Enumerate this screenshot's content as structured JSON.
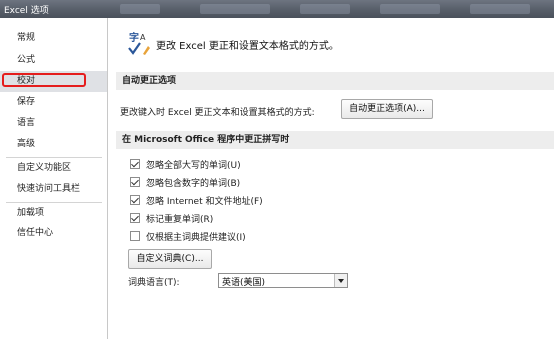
{
  "window": {
    "title": "Excel 选项"
  },
  "nav": {
    "items": [
      {
        "label": "常规"
      },
      {
        "label": "公式"
      },
      {
        "label": "校对"
      },
      {
        "label": "保存"
      },
      {
        "label": "语言"
      },
      {
        "label": "高级"
      },
      {
        "label": "自定义功能区"
      },
      {
        "label": "快速访问工具栏"
      },
      {
        "label": "加载项"
      },
      {
        "label": "信任中心"
      }
    ],
    "selected": "校对"
  },
  "main": {
    "header_icon": "abc-spellcheck-icon",
    "header_text": "更改 Excel 更正和设置文本格式的方式。",
    "autocorrect": {
      "section_title": "自动更正选项",
      "description": "更改键入时 Excel 更正文本和设置其格式的方式:",
      "button_label": "自动更正选项(A)..."
    },
    "spelling": {
      "section_title": "在 Microsoft Office 程序中更正拼写时",
      "options": [
        {
          "label": "忽略全部大写的单词(U)",
          "checked": true
        },
        {
          "label": "忽略包含数字的单词(B)",
          "checked": true
        },
        {
          "label": "忽略 Internet 和文件地址(F)",
          "checked": true
        },
        {
          "label": "标记重复单词(R)",
          "checked": true
        },
        {
          "label": "仅根据主词典提供建议(I)",
          "checked": false
        }
      ],
      "custom_dict_button": "自定义词典(C)...",
      "dict_language_label": "词典语言(T):",
      "dict_language_value": "英语(美国)"
    }
  }
}
